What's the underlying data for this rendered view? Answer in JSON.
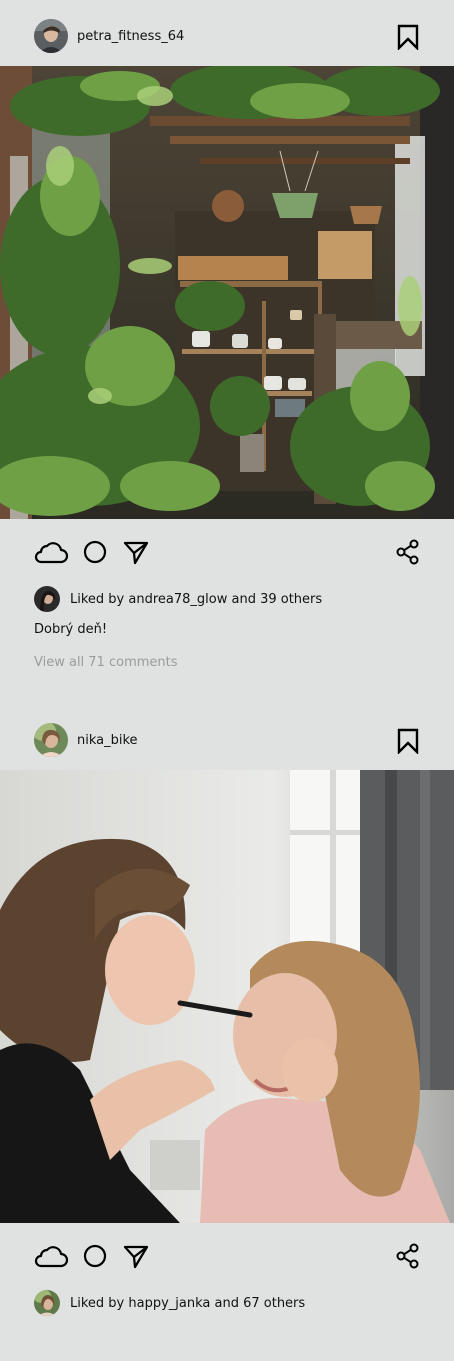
{
  "posts": [
    {
      "username": "petra_fitness_64",
      "liked_by_text": "Liked by andrea78_glow and 39 others",
      "caption": "Dobrý deň!",
      "view_comments": "View all 71 comments",
      "icons": {
        "save": "bookmark-icon",
        "like": "cloud-icon",
        "comment": "circle-icon",
        "send": "send-arrow-icon",
        "share": "share-icon"
      }
    },
    {
      "username": "nika_bike",
      "liked_by_text": "Liked by happy_janka and 67 others",
      "icons": {
        "save": "bookmark-icon",
        "like": "cloud-icon",
        "comment": "circle-icon",
        "send": "send-arrow-icon",
        "share": "share-icon"
      }
    }
  ],
  "colors": {
    "background": "#e0e2e1",
    "text": "#111111",
    "muted_text": "#9a9c9b"
  }
}
